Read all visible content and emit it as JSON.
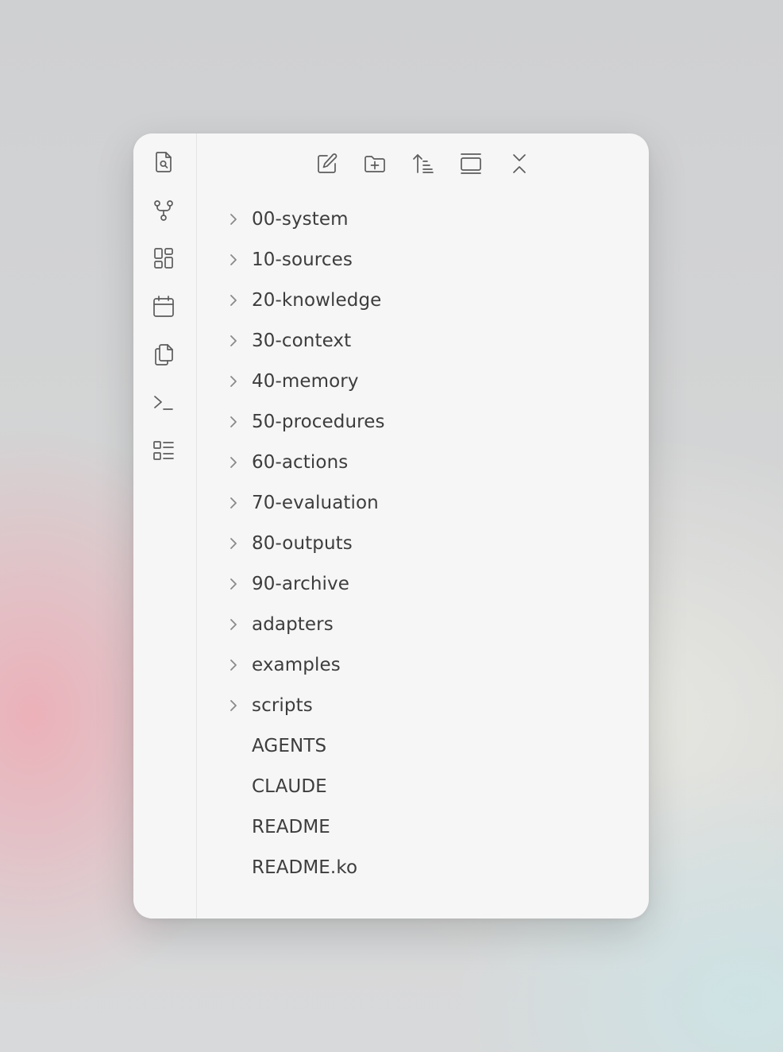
{
  "ribbon": {
    "items": [
      {
        "name": "search-file-icon"
      },
      {
        "name": "graph-view-icon"
      },
      {
        "name": "canvas-icon"
      },
      {
        "name": "calendar-icon"
      },
      {
        "name": "copy-files-icon"
      },
      {
        "name": "terminal-icon"
      },
      {
        "name": "checklist-icon"
      }
    ]
  },
  "toolbar": {
    "items": [
      {
        "name": "new-note-icon"
      },
      {
        "name": "new-folder-icon"
      },
      {
        "name": "sort-icon"
      },
      {
        "name": "auto-reveal-icon"
      },
      {
        "name": "collapse-all-icon"
      }
    ]
  },
  "tree": {
    "folders": [
      {
        "label": "00-system"
      },
      {
        "label": "10-sources"
      },
      {
        "label": "20-knowledge"
      },
      {
        "label": "30-context"
      },
      {
        "label": "40-memory"
      },
      {
        "label": "50-procedures"
      },
      {
        "label": "60-actions"
      },
      {
        "label": "70-evaluation"
      },
      {
        "label": "80-outputs"
      },
      {
        "label": "90-archive"
      },
      {
        "label": "adapters"
      },
      {
        "label": "examples"
      },
      {
        "label": "scripts"
      }
    ],
    "files": [
      {
        "label": "AGENTS"
      },
      {
        "label": "CLAUDE"
      },
      {
        "label": "README"
      },
      {
        "label": "README.ko"
      }
    ]
  },
  "colors": {
    "background": "#f6f6f6",
    "text": "#3d3d3d",
    "icon": "#5c5c5c",
    "chevron": "#8a8a8a"
  }
}
